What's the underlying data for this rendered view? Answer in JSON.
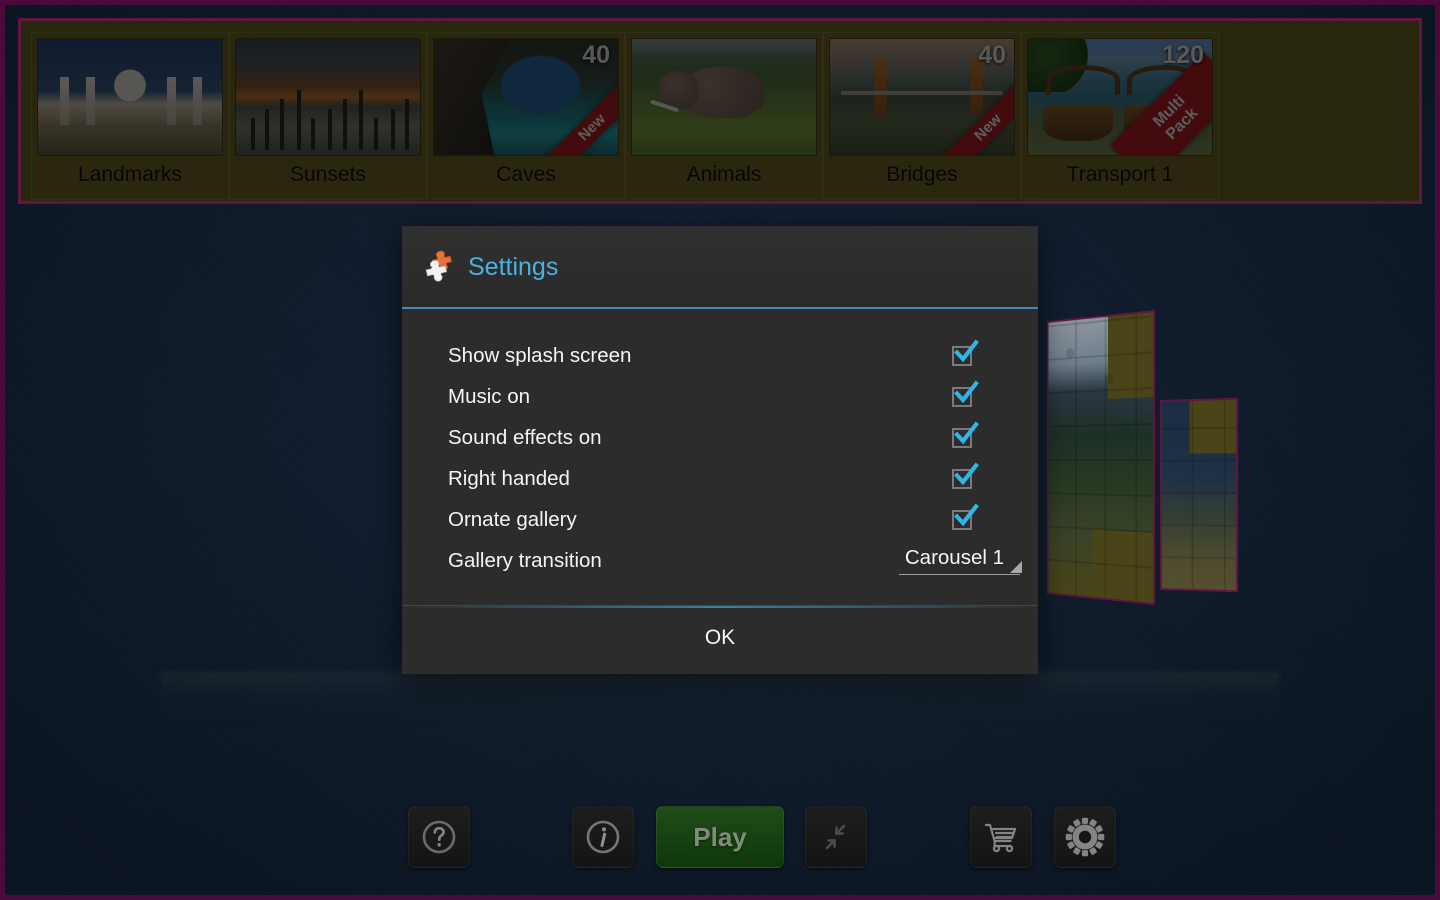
{
  "app": {
    "background_color": "#16283f",
    "frame_color": "#4a0a3c",
    "accent_color": "#4db1e0",
    "gallery_strip_color": "#6b6420"
  },
  "gallery": {
    "name": "puzzle-pack-gallery",
    "cards": [
      {
        "label": "Landmarks",
        "count": "",
        "ribbon": "",
        "art": "art-landmarks"
      },
      {
        "label": "Sunsets",
        "count": "",
        "ribbon": "",
        "art": "art-sunsets"
      },
      {
        "label": "Caves",
        "count": "40",
        "ribbon": "New",
        "art": "art-caves"
      },
      {
        "label": "Animals",
        "count": "",
        "ribbon": "",
        "art": "art-animals"
      },
      {
        "label": "Bridges",
        "count": "40",
        "ribbon": "New",
        "art": "art-bridges"
      },
      {
        "label": "Transport 1",
        "count": "120",
        "ribbon": "Multi Pack",
        "art": "art-transport"
      }
    ]
  },
  "dialog": {
    "title": "Settings",
    "icon": "puzzle-piece-icon",
    "settings": [
      {
        "label": "Show splash screen",
        "type": "checkbox",
        "checked": true,
        "value": ""
      },
      {
        "label": "Music on",
        "type": "checkbox",
        "checked": true,
        "value": ""
      },
      {
        "label": "Sound effects on",
        "type": "checkbox",
        "checked": true,
        "value": ""
      },
      {
        "label": "Right handed",
        "type": "checkbox",
        "checked": true,
        "value": ""
      },
      {
        "label": "Ornate gallery",
        "type": "checkbox",
        "checked": true,
        "value": ""
      },
      {
        "label": "Gallery transition",
        "type": "dropdown",
        "checked": false,
        "value": "Carousel 1"
      }
    ],
    "ok_label": "OK"
  },
  "toolbar": {
    "help_label": "help-icon",
    "info_label": "info-icon",
    "play_label": "Play",
    "collapse_label": "collapse-icon",
    "store_label": "shopping-cart-icon",
    "settings_label": "gear-icon"
  }
}
